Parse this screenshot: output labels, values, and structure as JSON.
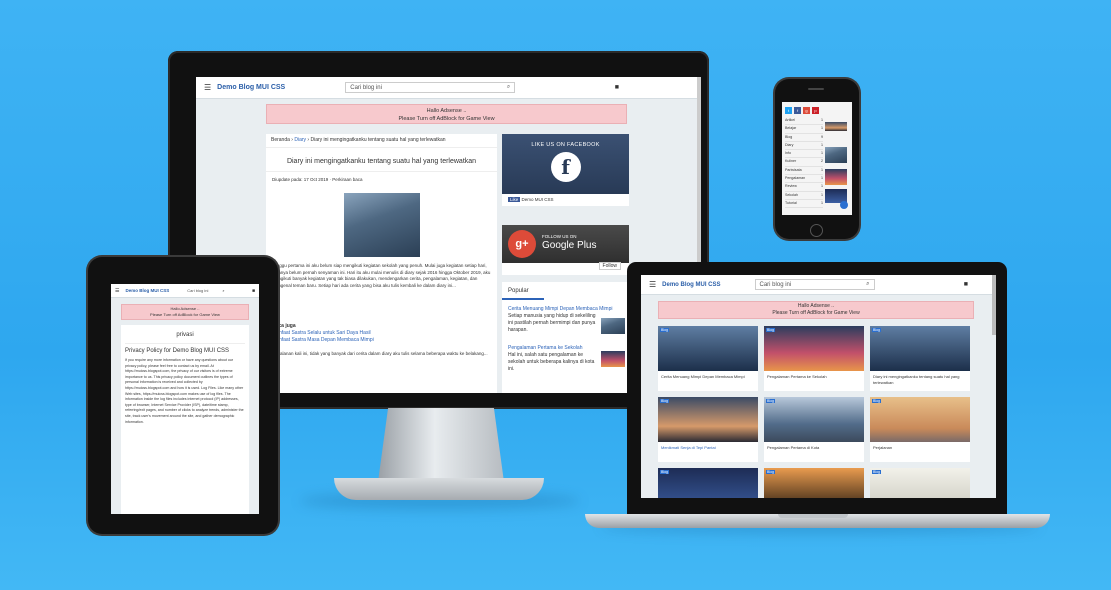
{
  "desktop": {
    "brand": "Demo Blog MUI CSS",
    "search_placeholder": "Cari blog ini",
    "alert_line1": "Hallo Adsense ..",
    "alert_line2": "Please Turn off AdBlock for Game View",
    "breadcrumb_home": "Beranda",
    "breadcrumb_cat": "Diary",
    "breadcrumb_current": "Diary ini mengingatkanku tentang suatu hal yang terlewatkan",
    "post_title": "Diary ini mengingatkanku tentang suatu hal yang terlewatkan",
    "post_meta": "Diupdate pada: 17 Oct 2019 · Perkiraan baca",
    "body_text": "Minggu pertama ini aku belum siap mengikuti kegiatan sekolah yang penuh. Mulai juga kegiatan setiap hari, rasanya belum pernah senyaman ini. Hari itu aku mulai menulis di diary sejak 2016 hingga Oktober 2019, aku mengikuti banyak kegiatan yang tak biasa dilakukan, mendengarkan cerita, pengalaman, kegiatan, dan mengenal teman baru. Setiap hari ada cerita yang bisa aku tulis kembali ke dalam diary ini...",
    "also_title": "Baca juga",
    "also_links": [
      "Manfaat Sastra Selalu untuk Sari Daya Hasil",
      "Manfaat Sastra Masa Depan Membaca Mimpi"
    ],
    "footer_text": "Perjalanan kali ini, tidak yang banyak dari cerita dalam diary aku tulis selama beberapa waktu ke belakang...",
    "fb_title": "LIKE US ON FACEBOOK",
    "fb_caption": "Demo MUI CSS",
    "gp_title": "FOLLOW US ON",
    "gp_name": "Google Plus",
    "gp_follow": "Follow",
    "popular_title": "Popular",
    "popular": [
      {
        "title": "Cerita Menuang Mimpi Depan Membaca Mimpi",
        "text": "Setiap manusia yang hidup di sekeliling ini pastilah pernah bermimpi dan punya harapan."
      },
      {
        "title": "Pengalaman Pertama ke Sekolah",
        "text": "Hal ini, salah satu pengalaman ke sekolah untuk beberapa kalinya di kota ini."
      }
    ]
  },
  "laptop": {
    "brand": "Demo Blog MUI CSS",
    "search_placeholder": "Cari blog ini",
    "alert_line1": "Hallo Adsense ..",
    "alert_line2": "Please Turn off AdBlock for Game View",
    "cards": [
      {
        "tag": "Blog",
        "title": "Cerita Menuang Mimpi Depan Membaca Mimpi",
        "photo": "ph-blue"
      },
      {
        "tag": "Blog",
        "title": "Pengalaman Pertama ke Sekolah",
        "photo": "ph-city"
      },
      {
        "tag": "Blog",
        "title": "Diary ini mengingatkanku tentang suatu hal yang terlewatkan",
        "photo": "ph-blue"
      },
      {
        "tag": "Blog",
        "title": "Menikmati Senja di Tepi Pantai",
        "photo": "ph-dawn"
      },
      {
        "tag": "Blog",
        "title": "Pengalaman Pertama di Kota",
        "photo": "ph-build"
      },
      {
        "tag": "Blog",
        "title": "Perjalanan",
        "photo": "ph-plane"
      },
      {
        "tag": "Blog",
        "title": "",
        "photo": "ph-night"
      },
      {
        "tag": "Blog",
        "title": "",
        "photo": "ph-sunset"
      },
      {
        "tag": "Blog",
        "title": "",
        "photo": "ph-light"
      }
    ]
  },
  "tablet": {
    "brand": "Demo Blog MUI CSS",
    "search_placeholder": "Cari blog ini",
    "alert_line1": "Hallo Adsense ..",
    "alert_line2": "Please Turn off AdBlock for Game View",
    "page_label": "privasi",
    "page_title": "Privacy Policy for Demo Blog MUI CSS",
    "body": "If you require any more information or have any questions about our privacy policy, please feel free to contact us by email. At https://muicss.blogspot.com, the privacy of our visitors is of extreme importance to us. This privacy policy document outlines the types of personal information is received and collected by https://muicss.blogspot.com and how it is used. Log Files. Like many other Web sites, https://muicss.blogspot.com makes use of log files. The information inside the log files includes internet protocol (IP) addresses, type of browser, Internet Service Provider (ISP), date/time stamp, referring/exit pages, and number of clicks to analyze trends, administer the site, track user's movement around the site, and gather demographic information."
  },
  "phone": {
    "social": [
      "t",
      "f",
      "g",
      "p"
    ],
    "labels": [
      {
        "name": "Artikel",
        "count": "1"
      },
      {
        "name": "Belajar",
        "count": "1"
      },
      {
        "name": "Blog",
        "count": "9"
      },
      {
        "name": "Diary",
        "count": "1"
      },
      {
        "name": "Info",
        "count": "1"
      },
      {
        "name": "Kuliner",
        "count": "2"
      },
      {
        "name": "Pariwisata",
        "count": "1"
      },
      {
        "name": "Pengalaman",
        "count": "1"
      },
      {
        "name": "Review",
        "count": "1"
      },
      {
        "name": "Sekolah",
        "count": "1"
      },
      {
        "name": "Tutorial",
        "count": "1"
      }
    ]
  },
  "colors": {
    "background": "#3fb3f4",
    "alert": "#f7c9cd",
    "link": "#2c63b8",
    "bezel": "#111111"
  }
}
